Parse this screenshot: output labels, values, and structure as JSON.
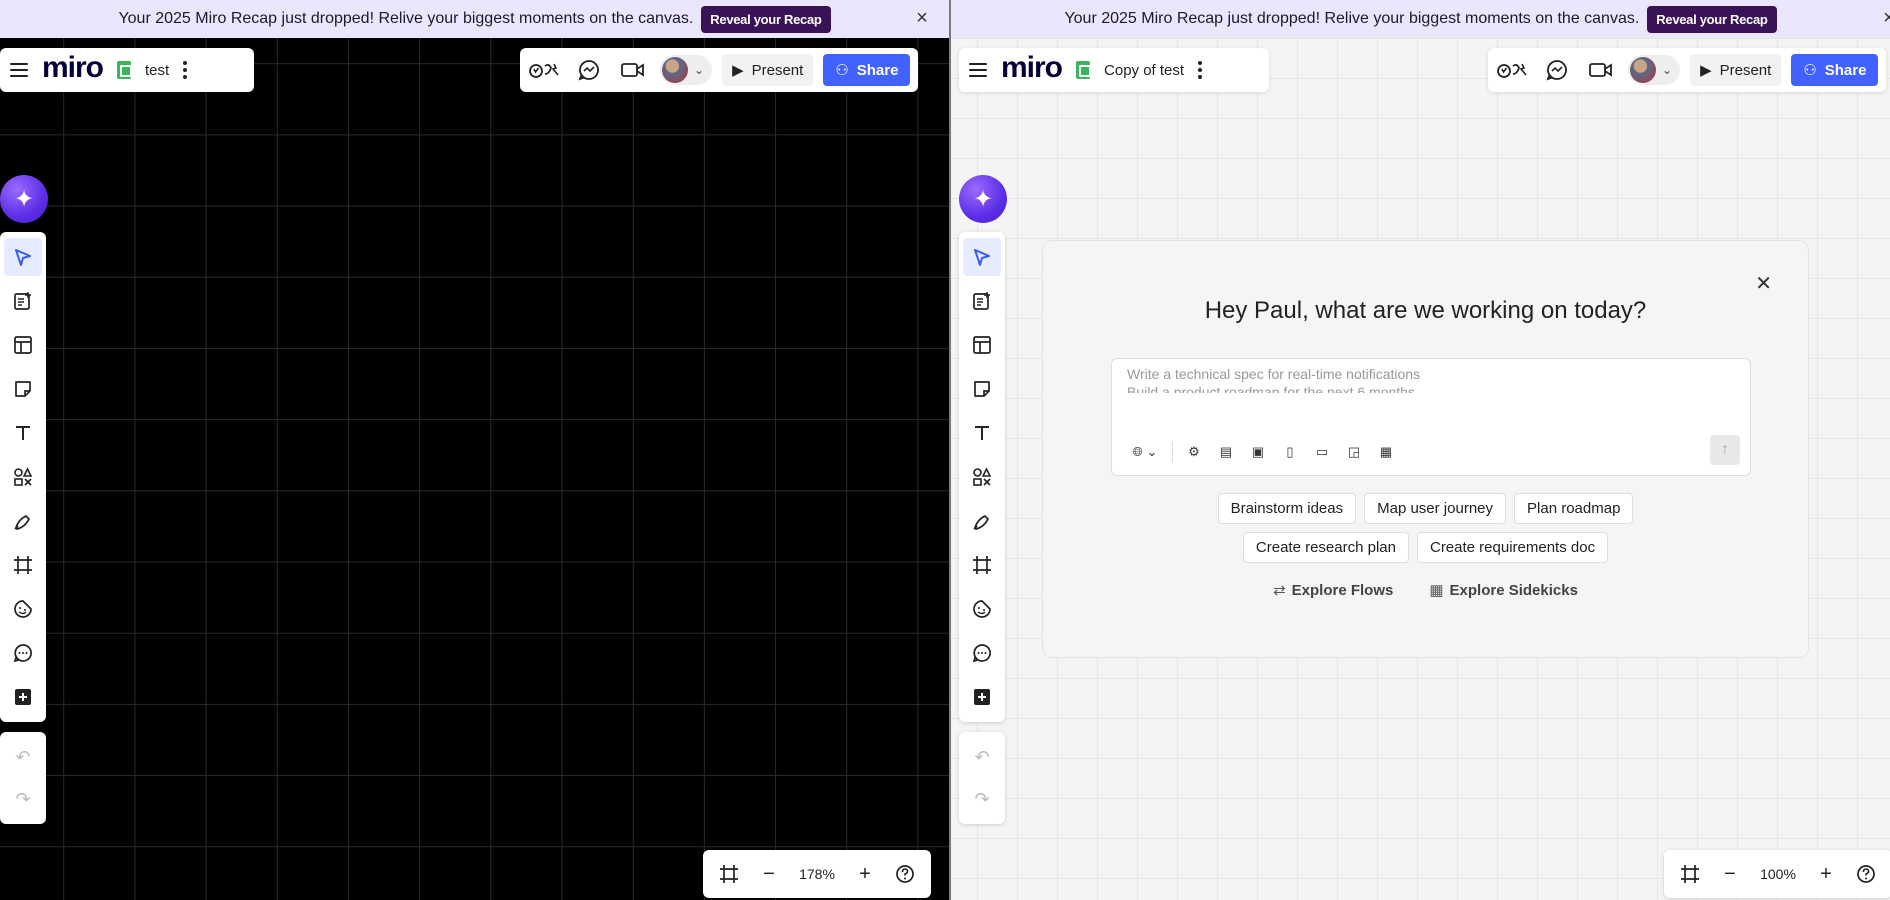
{
  "banner": {
    "message": "Your 2025 Miro Recap just dropped! Relive your biggest moments on the canvas.",
    "cta": "Reveal your Recap",
    "close": "×"
  },
  "left": {
    "board_name": "test",
    "logo": "miro",
    "present_label": "Present",
    "share_label": "Share",
    "zoom": "178%"
  },
  "right": {
    "board_name": "Copy of test",
    "logo": "miro",
    "present_label": "Present",
    "share_label": "Share",
    "zoom": "100%",
    "ai_panel": {
      "title": "Hey Paul, what are we working on today?",
      "hints": [
        "Write a technical spec for real-time notifications",
        "Build a product roadmap for the next 6 months"
      ],
      "chips": [
        "Brainstorm ideas",
        "Map user journey",
        "Plan roadmap",
        "Create research plan",
        "Create requirements doc"
      ],
      "explore_flows": "Explore Flows",
      "explore_sidekicks": "Explore Sidekicks"
    }
  },
  "icons": {
    "reactions": "reactions-icon",
    "comments": "comments-icon",
    "video": "video-icon",
    "ai": "sparkle-icon"
  },
  "colors": {
    "banner_bg": "#eae7fd",
    "reveal_bg": "#3a1357",
    "share_bg": "#4262ff",
    "board_icon": "#3bb55c",
    "ai_orb": "#5b2ee6"
  }
}
